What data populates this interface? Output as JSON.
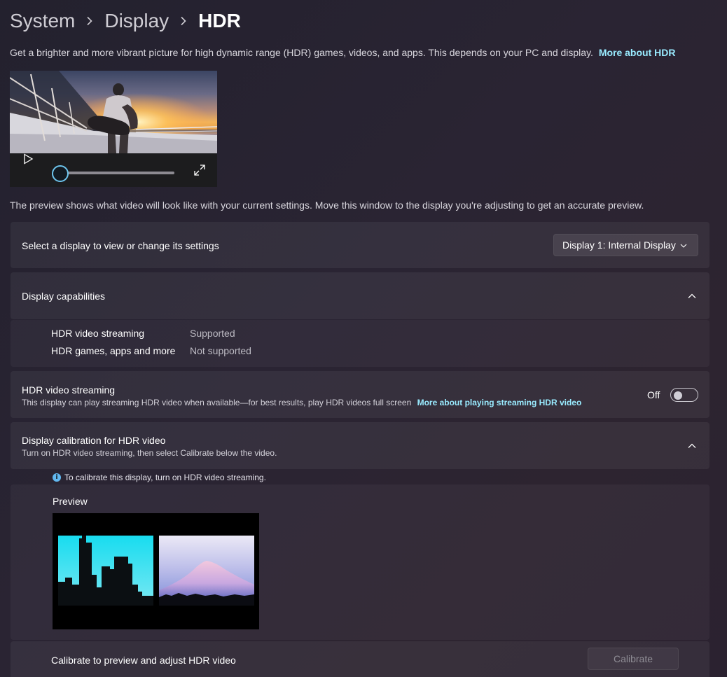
{
  "breadcrumb": {
    "items": [
      "System",
      "Display",
      "HDR"
    ]
  },
  "intro": {
    "text": "Get a brighter and more vibrant picture for high dynamic range (HDR) games, videos, and apps. This depends on your PC and display.",
    "link": "More about HDR"
  },
  "video": {
    "progress": 0
  },
  "preview_note": "The preview shows what video will look like with your current settings. Move this window to the display you're adjusting to get an accurate preview.",
  "select_display": {
    "label": "Select a display to view or change its settings",
    "value": "Display 1: Internal Display"
  },
  "capabilities": {
    "title": "Display capabilities",
    "rows": [
      {
        "label": "HDR video streaming",
        "value": "Supported"
      },
      {
        "label": "HDR games, apps and more",
        "value": "Not supported"
      }
    ]
  },
  "streaming": {
    "title": "HDR video streaming",
    "description": "This display can play streaming HDR video when available—for best results, play HDR videos full screen",
    "link": "More about playing streaming HDR video",
    "state": "Off"
  },
  "calibration": {
    "title": "Display calibration for HDR video",
    "description": "Turn on HDR video streaming, then select Calibrate below the video.",
    "info": "To calibrate this display, turn on HDR video streaming.",
    "preview_label": "Preview",
    "calibrate_label": "Calibrate to preview and adjust HDR video",
    "calibrate_button": "Calibrate"
  },
  "icons": {
    "breadcrumb_separator": "chevron-right-icon",
    "play": "play-icon",
    "fullscreen": "fullscreen-icon",
    "dropdown": "chevron-down-icon",
    "collapse": "chevron-up-icon",
    "info": "info-icon"
  },
  "colors": {
    "link": "#99ebff",
    "accent": "#6ec5ee",
    "info": "#62b8f0"
  }
}
